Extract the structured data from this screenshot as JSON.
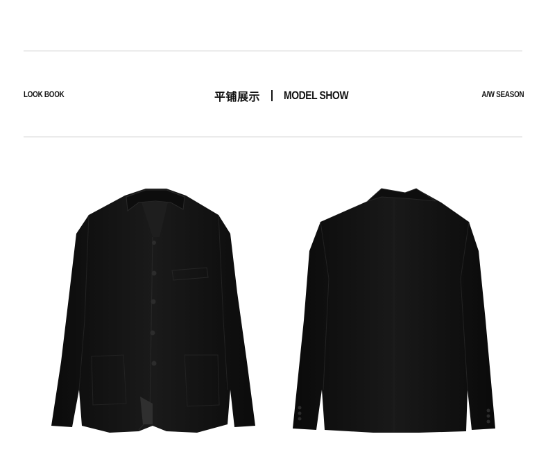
{
  "header": {
    "left_label": "LOOK BOOK",
    "title_cn": "平铺展示",
    "title_en": "MODEL SHOW",
    "right_label": "A/W SEASON"
  },
  "images": {
    "front": {
      "icon": "jacket-front",
      "color": "#141414"
    },
    "back": {
      "icon": "jacket-back",
      "color": "#141414"
    }
  },
  "colors": {
    "background": "#ffffff",
    "rule": "#c9c9c9",
    "text": "#111111"
  }
}
